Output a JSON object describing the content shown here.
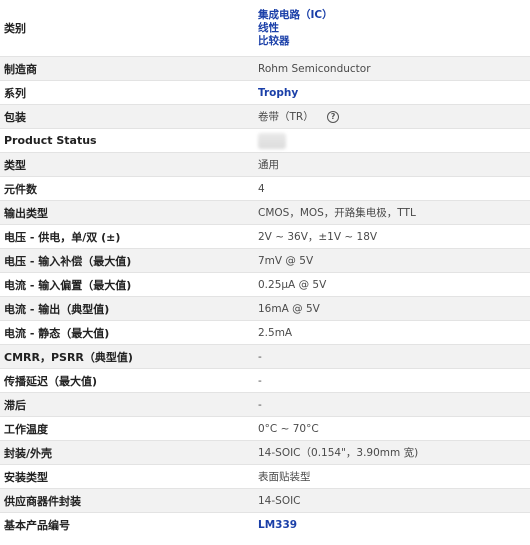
{
  "rows": {
    "category": {
      "label": "类别",
      "links": [
        "集成电路（IC）",
        "线性",
        "比较器"
      ]
    },
    "manufacturer": {
      "label": "制造商",
      "value": "Rohm Semiconductor"
    },
    "series": {
      "label": "系列",
      "value": "Trophy"
    },
    "package": {
      "label": "包装",
      "value": "卷带（TR）",
      "help_icon": "question-circle-icon"
    },
    "product_status": {
      "label": "Product Status",
      "value": ""
    },
    "type": {
      "label": "类型",
      "value": "通用"
    },
    "element_count": {
      "label": "元件数",
      "value": "4"
    },
    "output_type": {
      "label": "输出类型",
      "value": "CMOS，MOS，开路集电极，TTL"
    },
    "supply_voltage": {
      "label": "电压 - 供电，单/双 (±)",
      "value": "2V ~ 36V，±1V ~ 18V"
    },
    "input_offset_voltage": {
      "label": "电压 - 输入补偿（最大值)",
      "value": "7mV @ 5V"
    },
    "input_bias_current": {
      "label": "电流 - 输入偏置（最大值)",
      "value": "0.25µA @ 5V"
    },
    "output_current": {
      "label": "电流 - 输出（典型值)",
      "value": "16mA @ 5V"
    },
    "quiescent_current": {
      "label": "电流 - 静态（最大值)",
      "value": "2.5mA"
    },
    "cmrr_psrr": {
      "label": "CMRR，PSRR（典型值)",
      "value": "-"
    },
    "propagation_delay": {
      "label": "传播延迟（最大值)",
      "value": "-"
    },
    "hysteresis": {
      "label": "滞后",
      "value": "-"
    },
    "operating_temp": {
      "label": "工作温度",
      "value": "0°C ~ 70°C"
    },
    "package_case": {
      "label": "封装/外壳",
      "value": "14-SOIC（0.154\"，3.90mm 宽)"
    },
    "mounting_type": {
      "label": "安装类型",
      "value": "表面贴装型"
    },
    "supplier_device_package": {
      "label": "供应商器件封装",
      "value": "14-SOIC"
    },
    "base_part_number": {
      "label": "基本产品编号",
      "value": "LM339"
    }
  }
}
